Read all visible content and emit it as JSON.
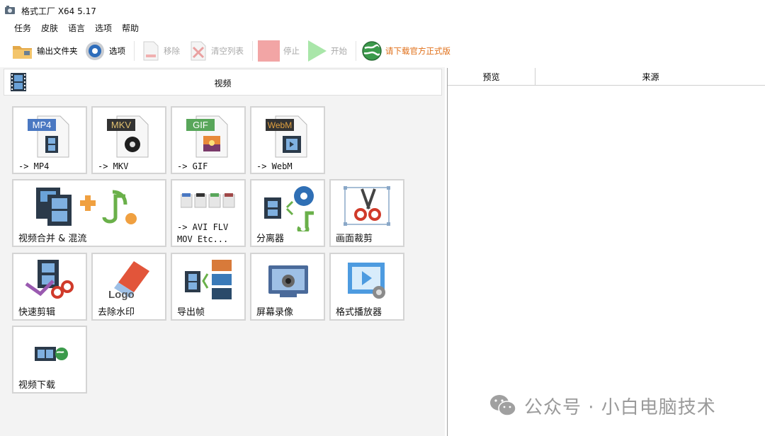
{
  "window": {
    "title": "格式工厂 X64 5.17"
  },
  "menu": [
    "任务",
    "皮肤",
    "语言",
    "选项",
    "帮助"
  ],
  "toolbar": {
    "output_folder": "输出文件夹",
    "options": "选项",
    "remove": "移除",
    "clear_list": "清空列表",
    "stop": "停止",
    "start": "开始",
    "download_official": "请下载官方正式版"
  },
  "category": {
    "title": "视频"
  },
  "tiles": {
    "mp4": {
      "badge": "MP4",
      "label": "-> MP4"
    },
    "mkv": {
      "badge": "MKV",
      "label": "-> MKV"
    },
    "gif": {
      "badge": "GIF",
      "label": "-> GIF"
    },
    "webm": {
      "badge": "WebM",
      "label": "-> WebM"
    },
    "merge": {
      "label": "视频合并 & 混流"
    },
    "other": {
      "label_line1": "-> AVI FLV",
      "label_line2": "MOV Etc..."
    },
    "splitter": {
      "label": "分离器"
    },
    "crop": {
      "label": "画面裁剪"
    },
    "quick_cut": {
      "label": "快速剪辑"
    },
    "remove_watermark": {
      "label": "去除水印",
      "logo_text": "Logo"
    },
    "export_frames": {
      "label": "导出帧"
    },
    "screen_record": {
      "label": "屏幕录像"
    },
    "player": {
      "label": "格式播放器"
    },
    "video_download": {
      "label": "视频下载"
    }
  },
  "file_list": {
    "columns": [
      "预览",
      "来源"
    ]
  },
  "watermark": {
    "text": "公众号 · 小白电脑技术"
  },
  "colors": {
    "badge_blue": "#4a78c2",
    "badge_dark": "#333333",
    "badge_green": "#58a65a",
    "badge_webm": "#333333",
    "stop_red": "#f0a0a0",
    "start_green": "#9ee09e",
    "download_orange": "#e0701a"
  }
}
